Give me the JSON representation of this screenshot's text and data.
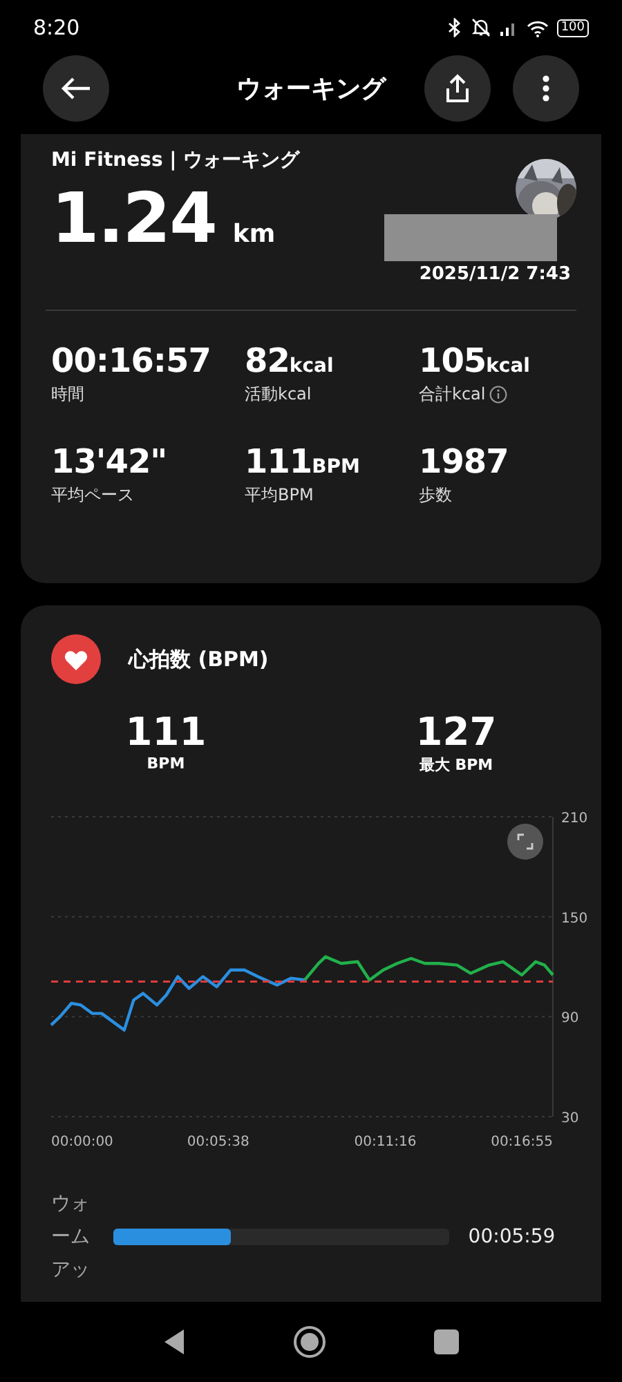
{
  "status_bar": {
    "time": "8:20",
    "battery": "100"
  },
  "header": {
    "title": "ウォーキング"
  },
  "summary": {
    "source": "Mi Fitness | ウォーキング",
    "distance": "1.24",
    "distance_unit": "km",
    "datetime": "2025/11/2 7:43",
    "metrics": [
      {
        "value": "00:16:57",
        "label": "時間"
      },
      {
        "value": "82",
        "unit": "kcal",
        "label": "活動kcal"
      },
      {
        "value": "105",
        "unit": "kcal",
        "label": "合計kcal",
        "info": true
      },
      {
        "value": "13'42\"",
        "label": "平均ペース"
      },
      {
        "value": "111",
        "unit": "BPM",
        "label": "平均BPM"
      },
      {
        "value": "1987",
        "label": "歩数"
      }
    ]
  },
  "heart_rate": {
    "title": "心拍数 (BPM)",
    "stats": [
      {
        "value": "111",
        "label": "BPM"
      },
      {
        "value": "127",
        "label": "最大 BPM"
      }
    ],
    "chart_data": {
      "type": "line",
      "x": [
        0,
        18,
        41,
        60,
        83,
        102,
        125,
        148,
        167,
        186,
        214,
        233,
        256,
        279,
        307,
        335,
        363,
        391,
        419,
        457,
        485,
        513,
        541,
        555,
        587,
        620,
        644,
        672,
        700,
        728,
        756,
        784,
        821,
        849,
        886,
        914,
        952,
        980,
        998,
        1015
      ],
      "series": [
        {
          "color": "#2b8fe0",
          "values": [
            85,
            90,
            98,
            97,
            92,
            92,
            87,
            82,
            100,
            104,
            97,
            103,
            114,
            107,
            114,
            108,
            118,
            118,
            114,
            109,
            113,
            112,
            null,
            null,
            null,
            null,
            null,
            null,
            null,
            null,
            null,
            null,
            null,
            null,
            null,
            null,
            null,
            null,
            null,
            null
          ]
        },
        {
          "color": "#22b04b",
          "values": [
            null,
            null,
            null,
            null,
            null,
            null,
            null,
            null,
            null,
            null,
            null,
            null,
            null,
            null,
            null,
            null,
            null,
            null,
            null,
            null,
            null,
            112,
            122,
            126,
            122,
            123,
            112,
            118,
            122,
            125,
            122,
            122,
            121,
            116,
            121,
            123,
            115,
            123,
            121,
            115
          ]
        },
        {
          "color": "#e03c3c",
          "line_style": "dashed",
          "values": [
            111,
            111,
            111,
            111,
            111,
            111,
            111,
            111,
            111,
            111,
            111,
            111,
            111,
            111,
            111,
            111,
            111,
            111,
            111,
            111,
            111,
            111,
            111,
            111,
            111,
            111,
            111,
            111,
            111,
            111,
            111,
            111,
            111,
            111,
            111,
            111,
            111,
            111,
            111,
            111
          ]
        }
      ],
      "xlim": [
        0,
        1015
      ],
      "ylim": [
        30,
        210
      ],
      "xticks": [
        {
          "value": 0,
          "label": "00:00:00"
        },
        {
          "value": 338,
          "label": "00:05:38"
        },
        {
          "value": 676,
          "label": "00:11:16"
        },
        {
          "value": 1015,
          "label": "00:16:55"
        }
      ],
      "yticks": [
        30,
        90,
        150,
        210
      ]
    },
    "zones": [
      {
        "label": "ウォームアッ",
        "level": 0.35,
        "duration": "00:05:59",
        "color": "#2b8fe0"
      }
    ]
  }
}
